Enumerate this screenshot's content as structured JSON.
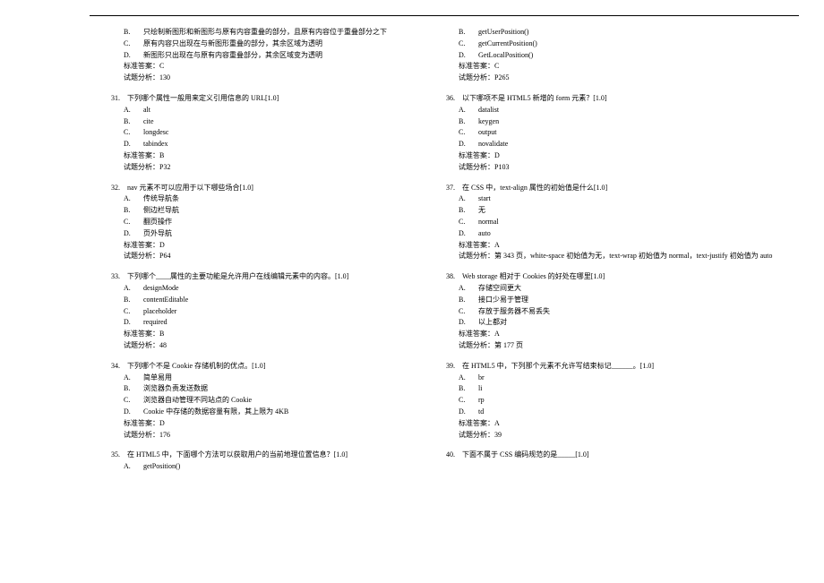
{
  "labels": {
    "answer": "标准答案：",
    "analysis": "试题分析："
  },
  "col1_top": {
    "opts": [
      {
        "l": "B.",
        "t": "只绘制新图形和新图形与原有内容重叠的部分，且原有内容位于重叠部分之下"
      },
      {
        "l": "C.",
        "t": "原有内容只出现在与新图形重叠的部分，其余区域为透明"
      },
      {
        "l": "D.",
        "t": "新图形只出现在与原有内容重叠部分，其余区域变为透明"
      }
    ],
    "answer": "C",
    "analysis": "130"
  },
  "col1_q": [
    {
      "num": "31.",
      "title": "下列哪个属性一般用来定义引用信息的 URL[1.0]",
      "opts": [
        {
          "l": "A.",
          "t": "alt"
        },
        {
          "l": "B.",
          "t": "cite"
        },
        {
          "l": "C.",
          "t": "longdesc"
        },
        {
          "l": "D.",
          "t": "tabindex"
        }
      ],
      "answer": "B",
      "analysis": "P32"
    },
    {
      "num": "32.",
      "title": "nav 元素不可以应用于以下哪些场合[1.0]",
      "opts": [
        {
          "l": "A.",
          "t": "传统导航条"
        },
        {
          "l": "B.",
          "t": "侧边栏导航"
        },
        {
          "l": "C.",
          "t": "翻页操作"
        },
        {
          "l": "D.",
          "t": "页外导航"
        }
      ],
      "answer": "D",
      "analysis": "P64"
    },
    {
      "num": "33.",
      "title": "下列哪个____属性的主要功能是允许用户在线编辑元素中的内容。[1.0]",
      "opts": [
        {
          "l": "A.",
          "t": "designMode"
        },
        {
          "l": "B.",
          "t": "contentEditable"
        },
        {
          "l": "C.",
          "t": "placeholder"
        },
        {
          "l": "D.",
          "t": "required"
        }
      ],
      "answer": "B",
      "analysis": "48"
    },
    {
      "num": "34.",
      "title": "下列哪个不是 Cookie 存储机制的优点。[1.0]",
      "opts": [
        {
          "l": "A.",
          "t": "简单易用"
        },
        {
          "l": "B.",
          "t": "浏览器负责发送数据"
        },
        {
          "l": "C.",
          "t": "浏览器自动管理不同站点的 Cookie"
        },
        {
          "l": "D.",
          "t": "Cookie 中存储的数据容量有限，其上限为 4KB"
        }
      ],
      "answer": "D",
      "analysis": "176"
    },
    {
      "num": "35.",
      "title": "在 HTML5 中，下面哪个方法可以获取用户的当前地理位置信息？[1.0]",
      "opts": [
        {
          "l": "A.",
          "t": "getPosition()"
        }
      ]
    }
  ],
  "col2_top": {
    "opts": [
      {
        "l": "B.",
        "t": "getUserPosition()"
      },
      {
        "l": "C.",
        "t": "getCurrentPosition()"
      },
      {
        "l": "D.",
        "t": "GetLocalPosition()"
      }
    ],
    "answer": "C",
    "analysis": "P265"
  },
  "col2_q": [
    {
      "num": "36.",
      "title": "以下哪项不是 HTML5 新增的 form 元素？[1.0]",
      "opts": [
        {
          "l": "A.",
          "t": "datalist"
        },
        {
          "l": "B.",
          "t": "keygen"
        },
        {
          "l": "C.",
          "t": "output"
        },
        {
          "l": "D.",
          "t": "novalidate"
        }
      ],
      "answer": "D",
      "analysis": "P103"
    },
    {
      "num": "37.",
      "title": "在 CSS 中，text-align 属性的初始值是什么[1.0]",
      "opts": [
        {
          "l": "A.",
          "t": "start"
        },
        {
          "l": "B.",
          "t": "无"
        },
        {
          "l": "C.",
          "t": "normal"
        },
        {
          "l": "D.",
          "t": "auto"
        }
      ],
      "answer": "A",
      "analysis": "第 343 页，white-space 初始值为无，text-wrap 初始值为 normal，text-justify 初始值为 auto"
    },
    {
      "num": "38.",
      "title": "Web storage 相对于 Cookies 的好处在哪里[1.0]",
      "opts": [
        {
          "l": "A.",
          "t": "存储空间更大"
        },
        {
          "l": "B.",
          "t": "接口少易于管理"
        },
        {
          "l": "C.",
          "t": "存放于服务器不易丢失"
        },
        {
          "l": "D.",
          "t": "以上都对"
        }
      ],
      "answer": "A",
      "analysis": "第 177 页"
    },
    {
      "num": "39.",
      "title": "在 HTML5 中，下列那个元素不允许写结束标记______。[1.0]",
      "opts": [
        {
          "l": "A.",
          "t": "br"
        },
        {
          "l": "B.",
          "t": "li"
        },
        {
          "l": "C.",
          "t": "rp"
        },
        {
          "l": "D.",
          "t": "td"
        }
      ],
      "answer": "A",
      "analysis": "39"
    },
    {
      "num": "40.",
      "title": "下面不属于 CSS 编码规范的是_____[1.0]"
    }
  ]
}
